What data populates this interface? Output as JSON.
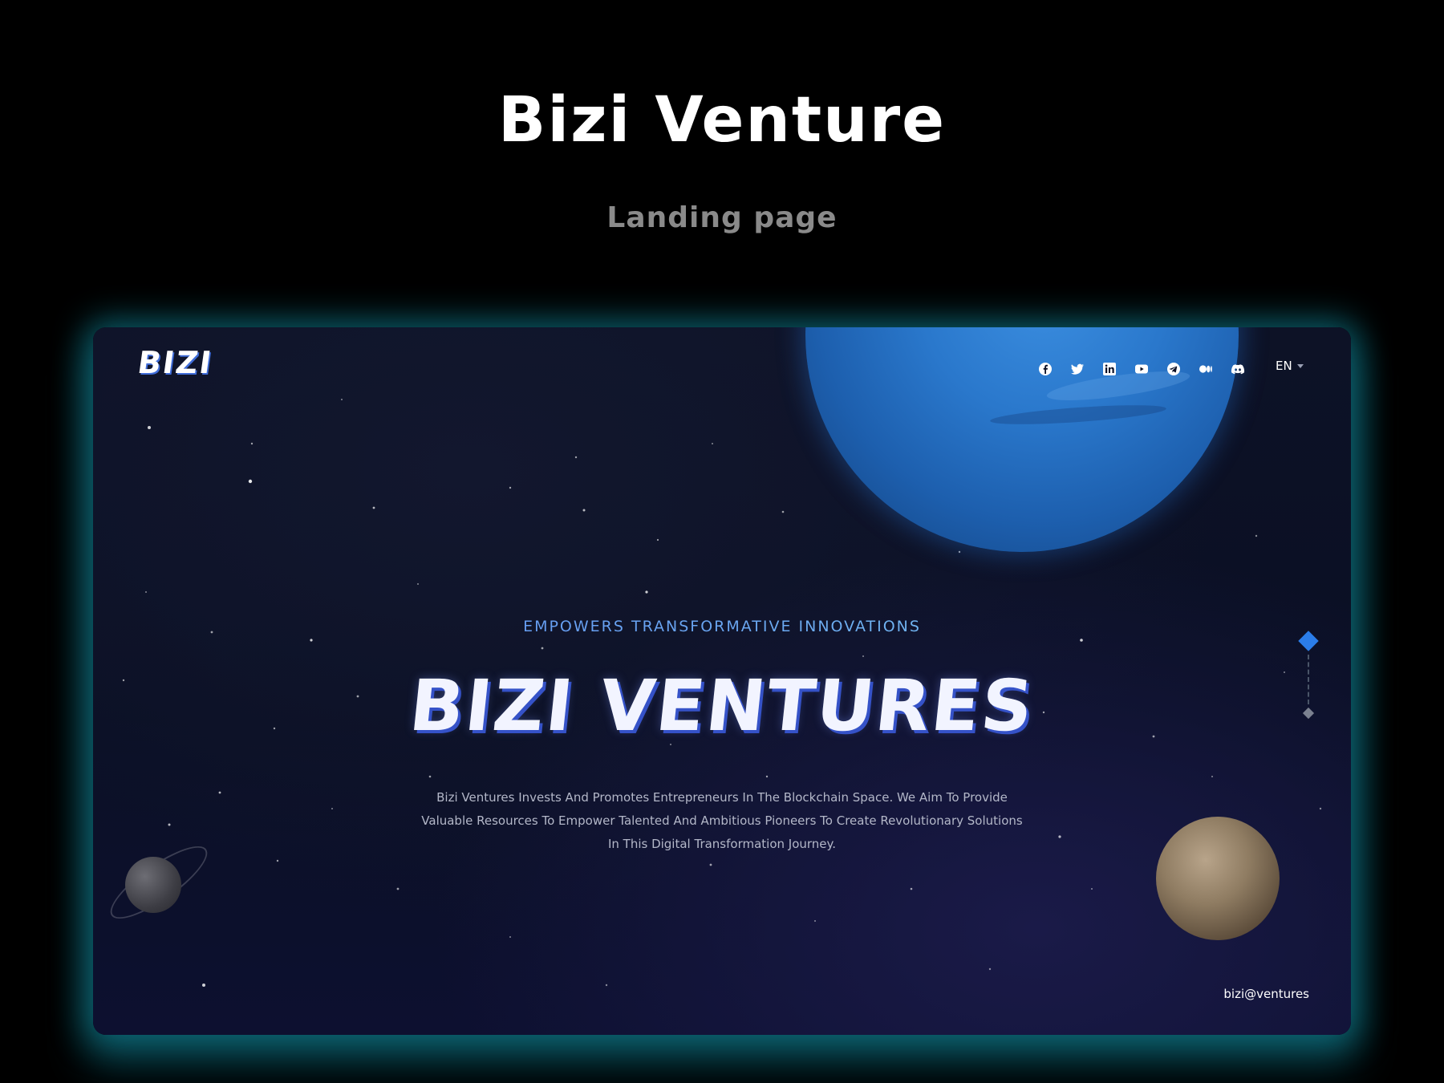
{
  "showcase": {
    "title": "Bizi Venture",
    "subtitle": "Landing page"
  },
  "header": {
    "logo_text": "BIZI",
    "social_icons": [
      "facebook-icon",
      "twitter-icon",
      "linkedin-icon",
      "youtube-icon",
      "telegram-icon",
      "medium-icon",
      "discord-icon"
    ],
    "language": "EN"
  },
  "hero": {
    "tagline": "EMPOWERS TRANSFORMATIVE INNOVATIONS",
    "title": "BIZI VENTURES",
    "description": "Bizi Ventures Invests And Promotes Entrepreneurs In The Blockchain Space. We Aim To Provide Valuable Resources To Empower Talented And Ambitious Pioneers To Create Revolutionary Solutions In This Digital Transformation Journey."
  },
  "footer": {
    "contact": "bizi@ventures"
  },
  "colors": {
    "page_background": "#000000",
    "frame_background": "#0b1026",
    "glow": "#1296aa",
    "accent_blue": "#2b7de9",
    "title_shadow": "#3552c8"
  }
}
